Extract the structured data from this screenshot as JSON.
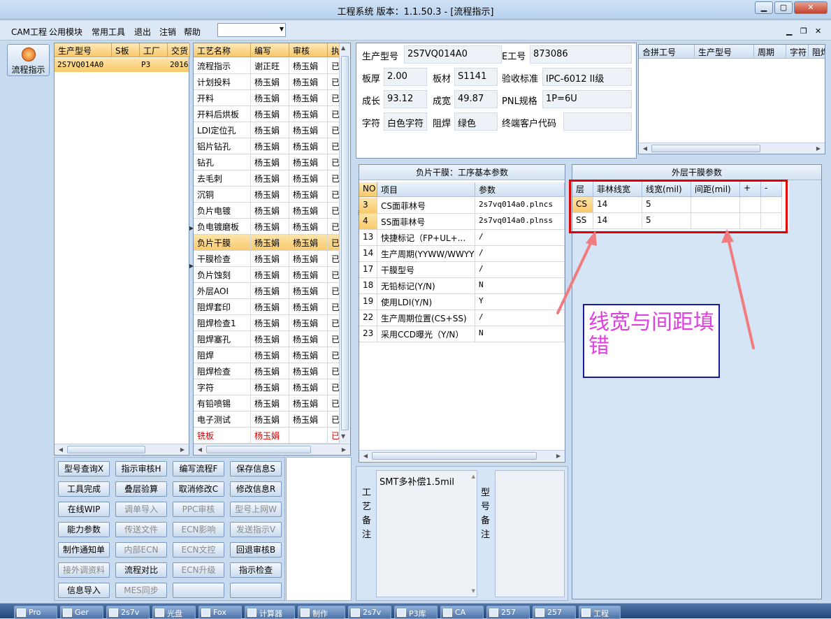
{
  "window": {
    "title": "工程系统   版本：1.1.50.3 - [流程指示]"
  },
  "menu": {
    "items": [
      "CAM工程",
      "公用模块",
      "常用工具",
      "退出",
      "注销",
      "帮助"
    ]
  },
  "sidebar": {
    "button_label": "流程指示"
  },
  "model_list": {
    "headers": [
      "生产型号",
      "S板",
      "工厂",
      "交货"
    ],
    "rows": [
      [
        "2S7VQ014A0",
        "",
        "P3",
        "2016"
      ]
    ]
  },
  "process_list": {
    "headers": [
      "工艺名称",
      "编写",
      "审核",
      "执"
    ],
    "rows": [
      [
        "流程指示",
        "谢正旺",
        "杨玉娟",
        "已"
      ],
      [
        "计划投料",
        "杨玉娟",
        "杨玉娟",
        "已"
      ],
      [
        "开料",
        "杨玉娟",
        "杨玉娟",
        "已"
      ],
      [
        "开料后烘板",
        "杨玉娟",
        "杨玉娟",
        "已"
      ],
      [
        "LDI定位孔",
        "杨玉娟",
        "杨玉娟",
        "已"
      ],
      [
        "铝片钻孔",
        "杨玉娟",
        "杨玉娟",
        "已"
      ],
      [
        "钻孔",
        "杨玉娟",
        "杨玉娟",
        "已"
      ],
      [
        "去毛刺",
        "杨玉娟",
        "杨玉娟",
        "已"
      ],
      [
        "沉铜",
        "杨玉娟",
        "杨玉娟",
        "已"
      ],
      [
        "负片电镀",
        "杨玉娟",
        "杨玉娟",
        "已"
      ],
      [
        "负电镀磨板",
        "杨玉娟",
        "杨玉娟",
        "已"
      ],
      [
        "负片干膜",
        "杨玉娟",
        "杨玉娟",
        "已"
      ],
      [
        "干膜检查",
        "杨玉娟",
        "杨玉娟",
        "已"
      ],
      [
        "负片蚀刻",
        "杨玉娟",
        "杨玉娟",
        "已"
      ],
      [
        "外层AOI",
        "杨玉娟",
        "杨玉娟",
        "已"
      ],
      [
        "阻焊套印",
        "杨玉娟",
        "杨玉娟",
        "已"
      ],
      [
        "阻焊检查1",
        "杨玉娟",
        "杨玉娟",
        "已"
      ],
      [
        "阻焊塞孔",
        "杨玉娟",
        "杨玉娟",
        "已"
      ],
      [
        "阻焊",
        "杨玉娟",
        "杨玉娟",
        "已"
      ],
      [
        "阻焊检查",
        "杨玉娟",
        "杨玉娟",
        "已"
      ],
      [
        "字符",
        "杨玉娟",
        "杨玉娟",
        "已"
      ],
      [
        "有铅喷锡",
        "杨玉娟",
        "杨玉娟",
        "已"
      ],
      [
        "电子测试",
        "杨玉娟",
        "杨玉娟",
        "已"
      ],
      [
        "铣板",
        "杨玉娟",
        "",
        "已"
      ]
    ]
  },
  "buttons": [
    {
      "label": "型号查询X",
      "enabled": true
    },
    {
      "label": "指示审核H",
      "enabled": true
    },
    {
      "label": "编写流程F",
      "enabled": true
    },
    {
      "label": "保存信息S",
      "enabled": true
    },
    {
      "label": "工具完成",
      "enabled": true
    },
    {
      "label": "叠层验算",
      "enabled": true
    },
    {
      "label": "取消修改C",
      "enabled": true
    },
    {
      "label": "修改信息R",
      "enabled": true
    },
    {
      "label": "在线WIP",
      "enabled": true
    },
    {
      "label": "调单导入",
      "enabled": false
    },
    {
      "label": "PPC审核",
      "enabled": false
    },
    {
      "label": "型号上网W",
      "enabled": false
    },
    {
      "label": "能力参数",
      "enabled": true
    },
    {
      "label": "传送文件",
      "enabled": false
    },
    {
      "label": "ECN影响",
      "enabled": false
    },
    {
      "label": "发送指示V",
      "enabled": false
    },
    {
      "label": "制作通知单",
      "enabled": true
    },
    {
      "label": "内部ECN",
      "enabled": false
    },
    {
      "label": "ECN文控",
      "enabled": false
    },
    {
      "label": "回退审核B",
      "enabled": true
    },
    {
      "label": "接外调资料",
      "enabled": false
    },
    {
      "label": "流程对比",
      "enabled": true
    },
    {
      "label": "ECN升级",
      "enabled": false
    },
    {
      "label": "指示检查",
      "enabled": true
    },
    {
      "label": "信息导入",
      "enabled": true
    },
    {
      "label": "MES同步",
      "enabled": false
    },
    {
      "label": "",
      "enabled": true
    },
    {
      "label": "",
      "enabled": true
    }
  ],
  "info": {
    "prod_model_label": "生产型号",
    "prod_model": "2S7VQ014A0",
    "e_worker_label": "E工号",
    "e_worker": "873086",
    "thickness_label": "板厚",
    "thickness": "2.00",
    "material_label": "板材",
    "material": "S1141",
    "standard_label": "验收标准",
    "standard": "IPC-6012 II级",
    "length_label": "成长",
    "length": "93.12",
    "width_label": "成宽",
    "width": "49.87",
    "pnl_label": "PNL规格",
    "pnl": "1P=6U",
    "char_label": "字符",
    "char": "白色字符",
    "mask_label": "阻焊",
    "mask": "绿色",
    "customer_label": "终端客户代码",
    "customer": ""
  },
  "combine_table": {
    "headers": [
      "合拼工号",
      "生产型号",
      "周期",
      "字符",
      "阻焊"
    ]
  },
  "film_params": {
    "title": "负片干膜：工序基本参数",
    "headers": [
      "NO",
      "项目",
      "参数"
    ],
    "rows": [
      [
        "3",
        "CS面菲林号",
        "2s7vq014a0.plncs"
      ],
      [
        "4",
        "SS面菲林号",
        "2s7vq014a0.plnss"
      ],
      [
        "13",
        "快捷标记（FP+UL+...",
        "/"
      ],
      [
        "14",
        "生产周期(YYWW/WWYY)",
        "/"
      ],
      [
        "17",
        "干膜型号",
        "/"
      ],
      [
        "18",
        "无铅标记(Y/N)",
        "N"
      ],
      [
        "19",
        "使用LDI(Y/N)",
        "Y"
      ],
      [
        "22",
        "生产周期位置(CS+SS)",
        "/"
      ],
      [
        "23",
        "采用CCD曝光（Y/N）",
        "N"
      ]
    ]
  },
  "outer_params": {
    "title": "外层干膜参数",
    "headers": [
      "层",
      "菲林线宽",
      "线宽(mil)",
      "间距(mil)",
      "+",
      "-"
    ],
    "rows": [
      [
        "CS",
        "14",
        "5",
        "",
        "",
        ""
      ],
      [
        "SS",
        "14",
        "5",
        "",
        "",
        ""
      ]
    ]
  },
  "notes": {
    "process_label": "工艺备注",
    "process_text": "SMT多补偿1.5mil",
    "model_label": "型号备注"
  },
  "annotation": {
    "text": "线宽与间距填错",
    "color": "#e040e0",
    "box_color": "#1a1aa0",
    "highlight_color": "#e00000",
    "arrow_color": "#f07c80"
  },
  "taskbar": {
    "items": [
      "Pro",
      "Ger",
      "2s7v",
      "光盘",
      "Fox",
      "计算器",
      "制作",
      "2s7v",
      "P3库",
      "CA",
      "257",
      "257",
      "工程"
    ]
  }
}
